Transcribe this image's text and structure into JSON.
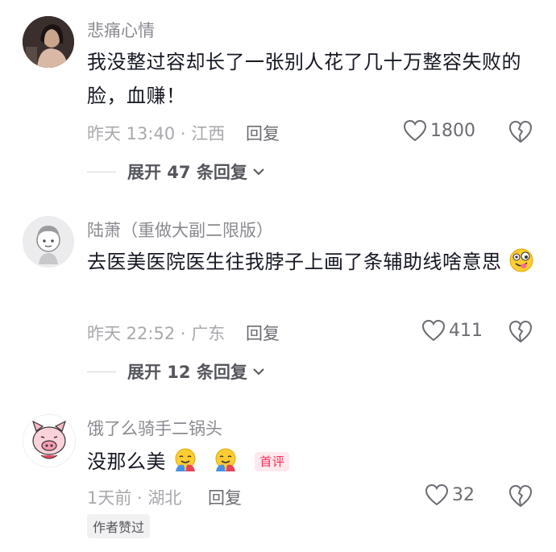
{
  "comments": [
    {
      "username": "悲痛心情",
      "text": "我没整过容却长了一张别人花了几十万整容失败的脸，血赚！",
      "meta": "昨天 13:40 · 江西",
      "reply_label": "回复",
      "likes": "1800",
      "expand_label": "展开 47 条回复"
    },
    {
      "username": "陆萧（重做大副二限版）",
      "text": "去医美医院医生往我脖子上画了条辅助线啥意思",
      "meta": "昨天 22:52 · 广东",
      "reply_label": "回复",
      "likes": "411",
      "expand_label": "展开 12 条回复"
    },
    {
      "username": "饿了么骑手二锅头",
      "text": "没那么美",
      "badge": "首评",
      "meta": "1天前 · 湖北",
      "reply_label": "回复",
      "likes": "32",
      "author_tag": "作者赞过"
    }
  ],
  "icons": {
    "like": "heart-outline-icon",
    "dislike": "broken-heart-icon",
    "expand": "chevron-down-icon",
    "emoji_1": "tongue-face-emoji",
    "emoji_2": "hugging-face-emoji"
  },
  "colors": {
    "badge": "#fe2c55",
    "meta": "#a8a9ad",
    "text": "#161823"
  }
}
